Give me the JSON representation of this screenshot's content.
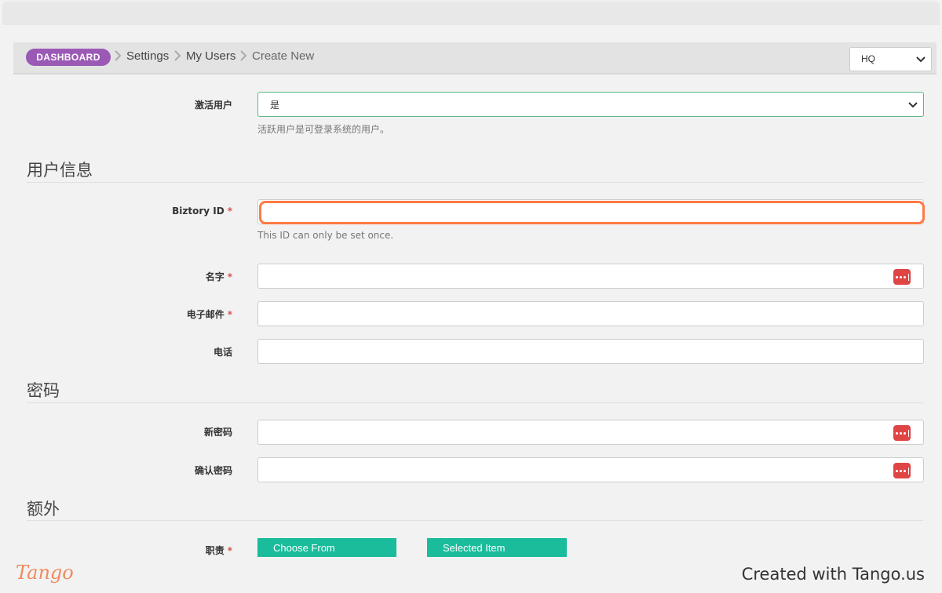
{
  "breadcrumb": {
    "dashboard": "DASHBOARD",
    "settings": "Settings",
    "my_users": "My Users",
    "current": "Create New"
  },
  "location_select": {
    "value": "HQ"
  },
  "active_user": {
    "label": "激活用户",
    "value": "是",
    "help": "活跃用户是可登录系统的用户。"
  },
  "sections": {
    "user_info": "用户信息",
    "password": "密码",
    "extra": "额外"
  },
  "fields": {
    "biztory_id": {
      "label": "Biztory ID",
      "required": "*",
      "value": "",
      "help": "This ID can only be set once."
    },
    "name": {
      "label": "名字",
      "required": "*",
      "value": ""
    },
    "email": {
      "label": "电子邮件",
      "required": "*",
      "value": ""
    },
    "phone": {
      "label": "电话",
      "value": ""
    },
    "new_password": {
      "label": "新密码",
      "value": ""
    },
    "confirm_password": {
      "label": "确认密码",
      "value": ""
    },
    "role": {
      "label": "职责",
      "required": "*"
    }
  },
  "role_lists": {
    "choose_from": "Choose From",
    "selected_item": "Selected Item"
  },
  "footer": {
    "brand": "Tango",
    "created_with": "Created with Tango.us"
  },
  "colors": {
    "dashboard_pill": "#9b59b6",
    "highlight": "#ff7a45",
    "teal_header": "#1abc9c",
    "required": "#d9534f",
    "password_icon": "#e04545"
  }
}
